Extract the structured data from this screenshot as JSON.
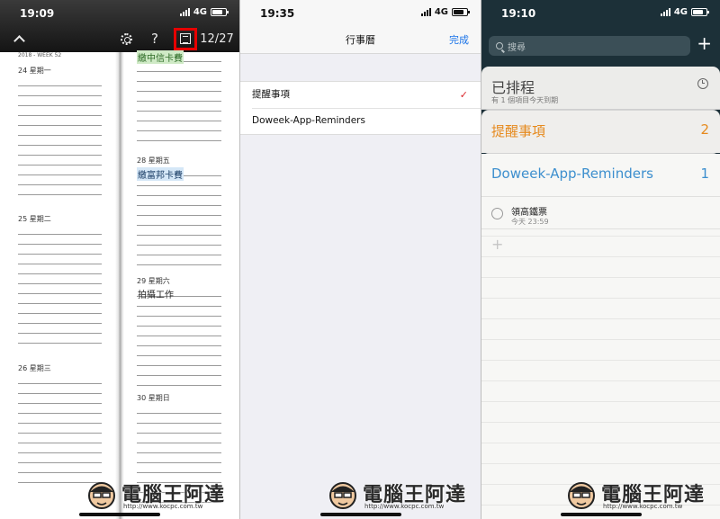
{
  "panel1": {
    "status": {
      "time": "19:09",
      "network": "4G"
    },
    "toolbar": {
      "page": "12/27"
    },
    "book": {
      "week_label": "2018 - WEEK 52",
      "days": [
        "24 星期一",
        "25 星期二",
        "26 星期三",
        "28 星期五",
        "29 星期六",
        "30 星期日"
      ],
      "entries": [
        "繳中信卡費",
        "繳富邦卡費",
        "拍攝工作"
      ]
    }
  },
  "panel2": {
    "status": {
      "time": "19:35",
      "network": "4G"
    },
    "nav": {
      "title": "行事曆",
      "done": "完成"
    },
    "calendars": [
      "提醒事項",
      "Doweek-App-Reminders"
    ],
    "check": "✓"
  },
  "panel3": {
    "status": {
      "time": "19:10",
      "network": "4G"
    },
    "search": {
      "placeholder": "搜尋"
    },
    "scheduled": {
      "title": "已排程",
      "subtitle": "有 1 個項目今天到期"
    },
    "lists": [
      {
        "name": "提醒事項",
        "count": "2",
        "color": "#e68a1e"
      },
      {
        "name": "Doweek-App-Reminders",
        "count": "1",
        "color": "#3d8fce"
      }
    ],
    "reminder": {
      "title": "領高鐵票",
      "due": "今天 23:59"
    }
  },
  "watermark": {
    "brand": "電腦王阿達",
    "url": "http://www.kocpc.com.tw"
  }
}
